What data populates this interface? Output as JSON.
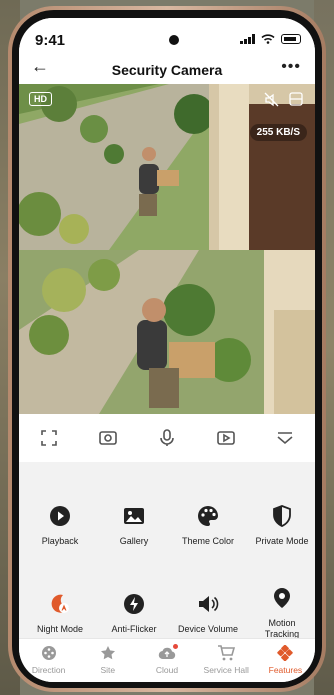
{
  "status": {
    "time": "9:41"
  },
  "header": {
    "title": "Security Camera"
  },
  "video": {
    "quality_badge": "HD",
    "bitrate": "255 KB/S"
  },
  "features": [
    {
      "label": "Playback",
      "icon": "play-circle-icon"
    },
    {
      "label": "Gallery",
      "icon": "image-icon"
    },
    {
      "label": "Theme Color",
      "icon": "palette-icon"
    },
    {
      "label": "Private Mode",
      "icon": "shield-half-icon"
    },
    {
      "label": "Night Mode",
      "icon": "night-mode-icon"
    },
    {
      "label": "Anti-Flicker",
      "icon": "bolt-icon"
    },
    {
      "label": "Device Volume",
      "icon": "speaker-icon"
    },
    {
      "label": "Motion Tracking",
      "icon": "location-pin-icon"
    }
  ],
  "tabs": [
    {
      "label": "Direction",
      "icon": "direction-icon",
      "active": false
    },
    {
      "label": "Site",
      "icon": "star-icon",
      "active": false
    },
    {
      "label": "Cloud",
      "icon": "cloud-icon",
      "active": false
    },
    {
      "label": "Service Hall",
      "icon": "cart-icon",
      "active": false
    },
    {
      "label": "Features",
      "icon": "features-icon",
      "active": true
    }
  ],
  "colors": {
    "accent": "#e05a2b",
    "icon_dark": "#222222",
    "night_mode": "#e05a2b"
  }
}
